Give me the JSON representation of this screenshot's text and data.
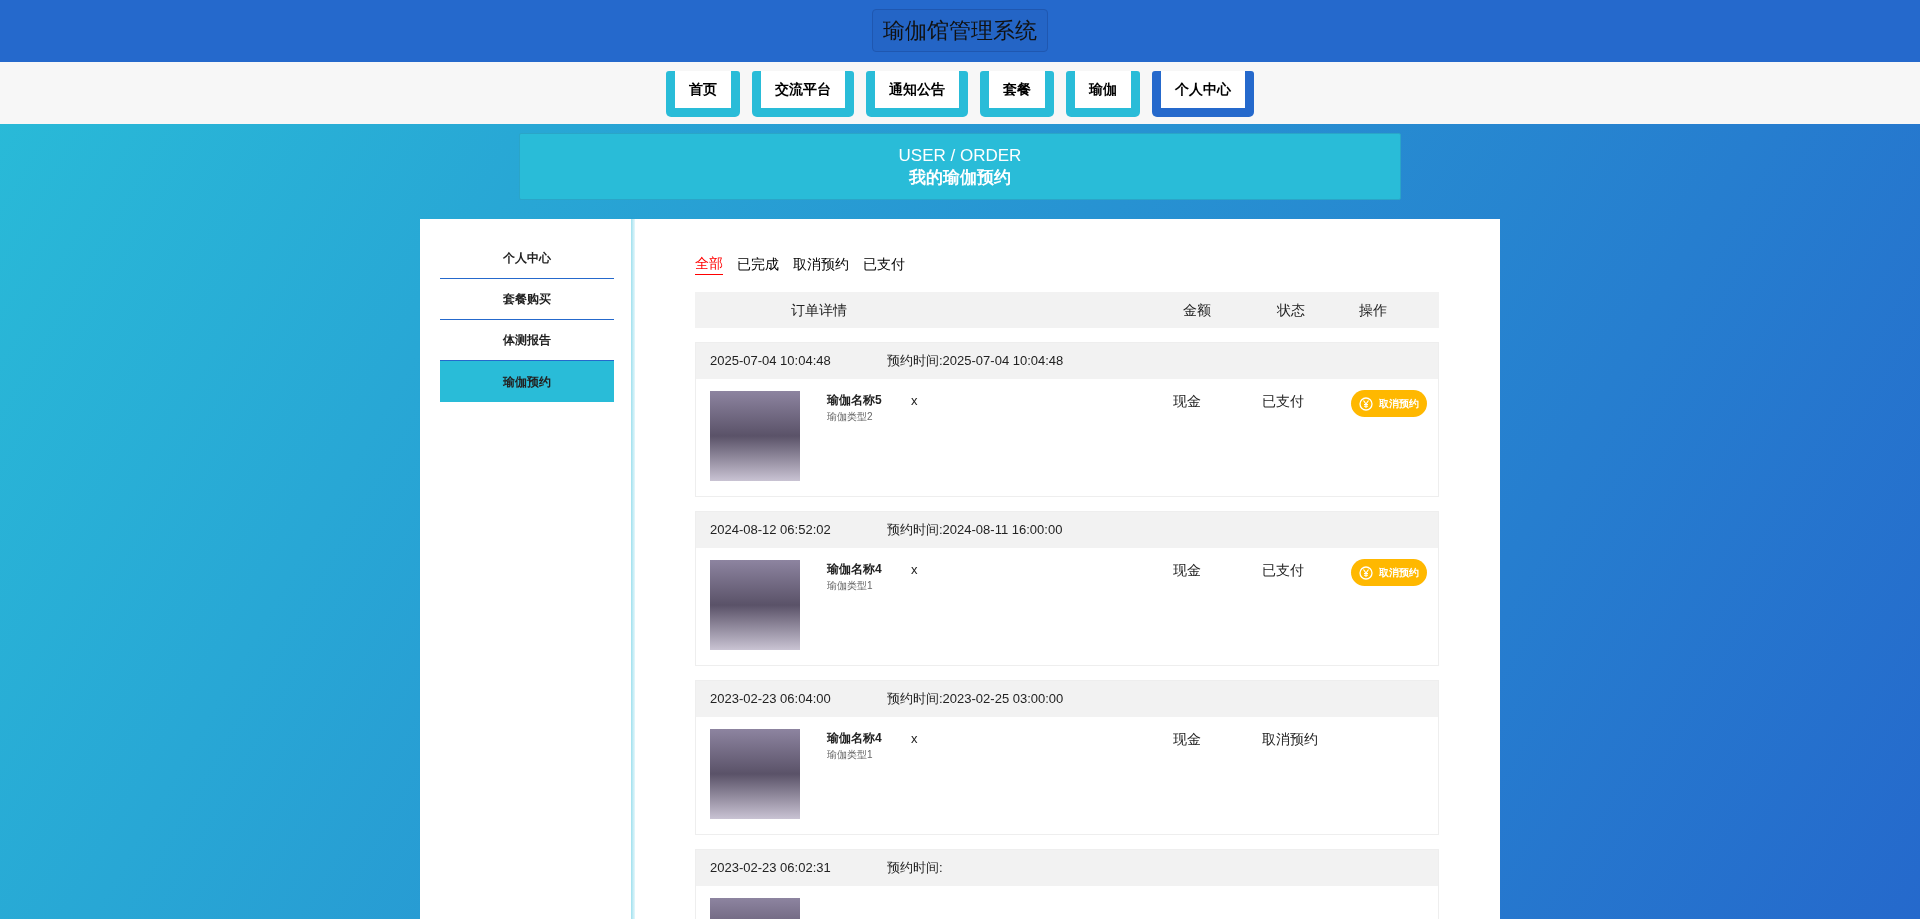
{
  "site_title": "瑜伽馆管理系统",
  "nav": [
    {
      "label": "首页",
      "selected": false
    },
    {
      "label": "交流平台",
      "selected": false
    },
    {
      "label": "通知公告",
      "selected": false
    },
    {
      "label": "套餐",
      "selected": false
    },
    {
      "label": "瑜伽",
      "selected": false
    },
    {
      "label": "个人中心",
      "selected": true
    }
  ],
  "banner": {
    "subtitle": "USER / ORDER",
    "title": "我的瑜伽预约"
  },
  "sidebar": [
    {
      "label": "个人中心",
      "selected": false
    },
    {
      "label": "套餐购买",
      "selected": false
    },
    {
      "label": "体测报告",
      "selected": false
    },
    {
      "label": "瑜伽预约",
      "selected": true
    }
  ],
  "filter_tabs": [
    {
      "label": "全部",
      "selected": true
    },
    {
      "label": "已完成",
      "selected": false
    },
    {
      "label": "取消预约",
      "selected": false
    },
    {
      "label": "已支付",
      "selected": false
    }
  ],
  "table_header": [
    "订单详情",
    "金额",
    "状态",
    "操作"
  ],
  "orders": [
    {
      "created": "2025-07-04 10:04:48",
      "booking": "预约时间:2025-07-04 10:04:48",
      "name": "瑜伽名称5",
      "type": "瑜伽类型2",
      "quantity": "x",
      "payment": "现金",
      "status": "已支付",
      "action": "取消预约"
    },
    {
      "created": "2024-08-12 06:52:02",
      "booking": "预约时间:2024-08-11 16:00:00",
      "name": "瑜伽名称4",
      "type": "瑜伽类型1",
      "quantity": "x",
      "payment": "现金",
      "status": "已支付",
      "action": "取消预约"
    },
    {
      "created": "2023-02-23 06:04:00",
      "booking": "预约时间:2023-02-25 03:00:00",
      "name": "瑜伽名称4",
      "type": "瑜伽类型1",
      "quantity": "x",
      "payment": "现金",
      "status": "取消预约"
    },
    {
      "created": "2023-02-23 06:02:31",
      "booking": "预约时间:"
    }
  ]
}
